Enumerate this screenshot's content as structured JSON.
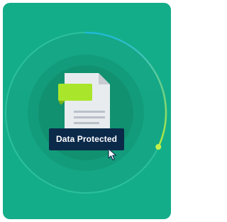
{
  "badge": {
    "label": "Data Protected"
  },
  "progress_ring": {
    "value_fraction": 0.32
  },
  "colors": {
    "card_background": "#14ad8a",
    "badge_background": "#0b2a4a",
    "highlight": "#a9e62b",
    "document": "#e8ecef",
    "progress_start": "#1fb8d6",
    "progress_end": "#b6ea3a"
  },
  "icons": {
    "document": "document-icon",
    "tag": "tag-icon",
    "cursor": "cursor-arrow-icon"
  }
}
